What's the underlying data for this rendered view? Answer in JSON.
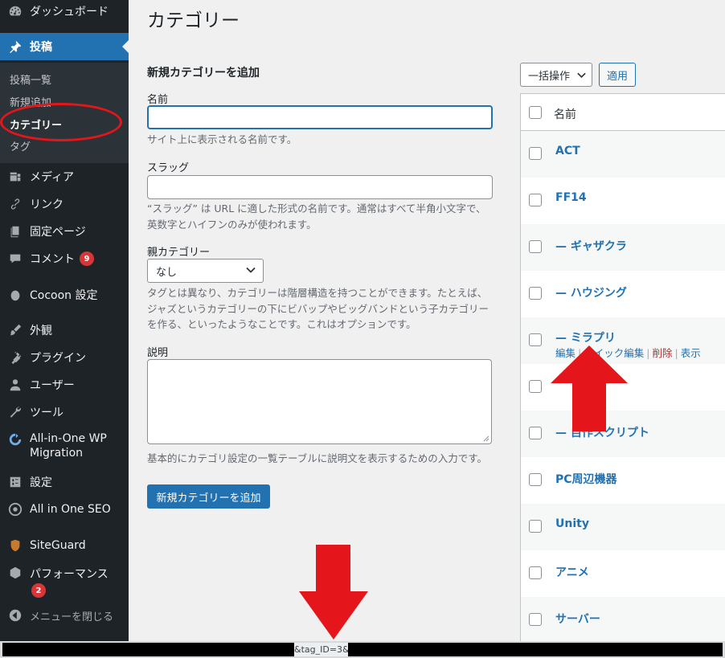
{
  "sidebar": {
    "items": [
      {
        "label": "ダッシュボード",
        "icon": "dashboard-icon"
      },
      {
        "label": "投稿",
        "icon": "pushpin-icon",
        "active": true
      },
      {
        "label": "メディア",
        "icon": "media-icon"
      },
      {
        "label": "リンク",
        "icon": "link-icon"
      },
      {
        "label": "固定ページ",
        "icon": "pages-icon"
      },
      {
        "label": "コメント",
        "icon": "comment-icon",
        "badge": "9"
      },
      {
        "label": "Cocoon 設定",
        "icon": "circle-icon"
      },
      {
        "label": "外観",
        "icon": "brush-icon"
      },
      {
        "label": "プラグイン",
        "icon": "plugin-icon"
      },
      {
        "label": "ユーザー",
        "icon": "user-icon"
      },
      {
        "label": "ツール",
        "icon": "wrench-icon"
      },
      {
        "label": "All-in-One WP Migration",
        "icon": "migration-icon"
      },
      {
        "label": "設定",
        "icon": "settings-icon"
      },
      {
        "label": "All in One SEO",
        "icon": "seo-icon"
      },
      {
        "label": "SiteGuard",
        "icon": "shield-icon"
      },
      {
        "label": "パフォーマンス",
        "icon": "performance-icon",
        "badge": "2"
      }
    ],
    "submenu": [
      {
        "label": "投稿一覧"
      },
      {
        "label": "新規追加"
      },
      {
        "label": "カテゴリー",
        "current": true
      },
      {
        "label": "タグ"
      }
    ],
    "collapse_label": "メニューを閉じる"
  },
  "page": {
    "title": "カテゴリー"
  },
  "form": {
    "title": "新規カテゴリーを追加",
    "name_label": "名前",
    "name_value": "",
    "name_help": "サイト上に表示される名前です。",
    "slug_label": "スラッグ",
    "slug_value": "",
    "slug_help": "“スラッグ” は URL に適した形式の名前です。通常はすべて半角小文字で、英数字とハイフンのみが使われます。",
    "parent_label": "親カテゴリー",
    "parent_value": "なし",
    "parent_help": "タグとは異なり、カテゴリーは階層構造を持つことができます。たとえば、ジャズというカテゴリーの下にビバップやビッグバンドという子カテゴリーを作る、といったようなことです。これはオプションです。",
    "desc_label": "説明",
    "desc_value": "",
    "desc_help": "基本的にカテゴリ設定の一覧テーブルに説明文を表示するための入力です。",
    "submit_label": "新規カテゴリーを追加"
  },
  "table": {
    "bulk_action": "一括操作",
    "apply_label": "適用",
    "header_name": "名前",
    "rows": [
      {
        "name": "ACT"
      },
      {
        "name": "FF14"
      },
      {
        "name": "— ギャザクラ"
      },
      {
        "name": "— ハウジング"
      },
      {
        "name": "— ミラプリ",
        "actions": [
          "編集",
          "クイック編集",
          "削除",
          "表示"
        ]
      },
      {
        "name": ""
      },
      {
        "name": "— 自作スクリプト"
      },
      {
        "name": "PC周辺機器"
      },
      {
        "name": "Unity"
      },
      {
        "name": "アニメ"
      },
      {
        "name": "サーバー"
      }
    ]
  },
  "status_bar": {
    "url_fragment": "&tag_ID=3&"
  },
  "colors": {
    "sidebar_bg": "#1d2327",
    "accent": "#2271b1",
    "annotation_red": "#e5161b"
  }
}
